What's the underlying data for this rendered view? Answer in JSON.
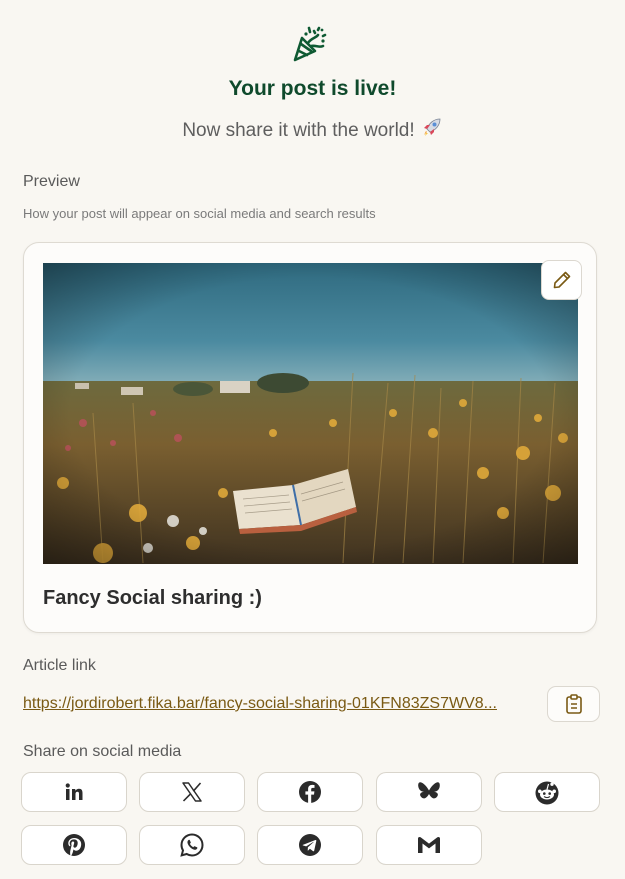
{
  "header": {
    "icon": "party-popper-icon",
    "title": "Your post is live!",
    "subtitle": "Now share it with the world!",
    "subtitle_emoji_icon": "rocket-icon"
  },
  "preview": {
    "label": "Preview",
    "hint": "How your post will appear on social media and search results",
    "image_icon": "field-with-open-book-photo",
    "title": "Fancy Social sharing :)",
    "edit_icon": "pencil-icon"
  },
  "article_link": {
    "label": "Article link",
    "url": "https://jordirobert.fika.bar/fancy-social-sharing-01KFN83ZS7WV8...",
    "copy_icon": "clipboard-icon"
  },
  "share": {
    "label": "Share on social media",
    "buttons": [
      {
        "icon": "linkedin-icon"
      },
      {
        "icon": "x-icon"
      },
      {
        "icon": "facebook-icon"
      },
      {
        "icon": "bluesky-icon"
      },
      {
        "icon": "reddit-icon"
      },
      {
        "icon": "pinterest-icon"
      },
      {
        "icon": "whatsapp-icon"
      },
      {
        "icon": "telegram-icon"
      },
      {
        "icon": "gmail-icon"
      }
    ]
  },
  "colors": {
    "background": "#f9f7f2",
    "headline_green": "#0f4a2c",
    "link_brown": "#7a5a14",
    "icon_dark": "#2b2b2b"
  }
}
